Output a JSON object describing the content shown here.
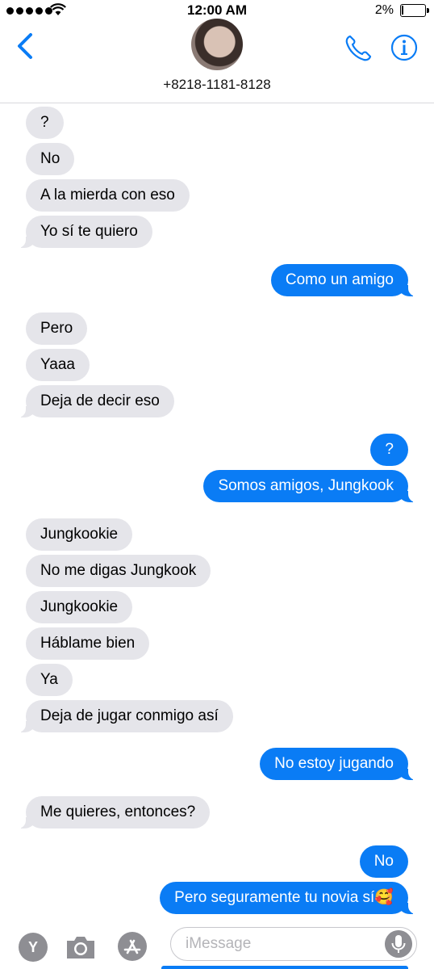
{
  "status_bar": {
    "time": "12:00 AM",
    "battery": "2%"
  },
  "header": {
    "contact_number": "+8218-1181-8128"
  },
  "messages": [
    {
      "side": "in",
      "text": "?",
      "tail": false
    },
    {
      "side": "in",
      "text": "No",
      "tail": false
    },
    {
      "side": "in",
      "text": "A la mierda con eso",
      "tail": false
    },
    {
      "side": "in",
      "text": "Yo sí te quiero",
      "tail": true
    },
    {
      "side": "out",
      "text": "Como un amigo",
      "tail": true
    },
    {
      "side": "in",
      "text": "Pero",
      "tail": false
    },
    {
      "side": "in",
      "text": "Yaaa",
      "tail": false
    },
    {
      "side": "in",
      "text": "Deja de decir eso",
      "tail": true
    },
    {
      "side": "out",
      "text": "?",
      "tail": false
    },
    {
      "side": "out",
      "text": "Somos amigos, Jungkook",
      "tail": true
    },
    {
      "side": "in",
      "text": "Jungkookie",
      "tail": false
    },
    {
      "side": "in",
      "text": "No me digas Jungkook",
      "tail": false
    },
    {
      "side": "in",
      "text": "Jungkookie",
      "tail": false
    },
    {
      "side": "in",
      "text": "Háblame bien",
      "tail": false
    },
    {
      "side": "in",
      "text": "Ya",
      "tail": false
    },
    {
      "side": "in",
      "text": "Deja de jugar conmigo así",
      "tail": true
    },
    {
      "side": "out",
      "text": "No estoy jugando",
      "tail": true
    },
    {
      "side": "in",
      "text": "Me quieres, entonces?",
      "tail": true
    },
    {
      "side": "out",
      "text": "No",
      "tail": false
    },
    {
      "side": "out",
      "text": "Pero seguramente tu novia sí🥰",
      "tail": true
    }
  ],
  "input_bar": {
    "app_label": "Y",
    "placeholder": "iMessage"
  },
  "colors": {
    "accent": "#0a7cf5",
    "incoming_bubble": "#e5e5ea",
    "outgoing_text": "#ffffff"
  },
  "icons": [
    "back-chevron-icon",
    "phone-icon",
    "info-icon",
    "camera-icon",
    "app-store-icon",
    "microphone-icon"
  ]
}
